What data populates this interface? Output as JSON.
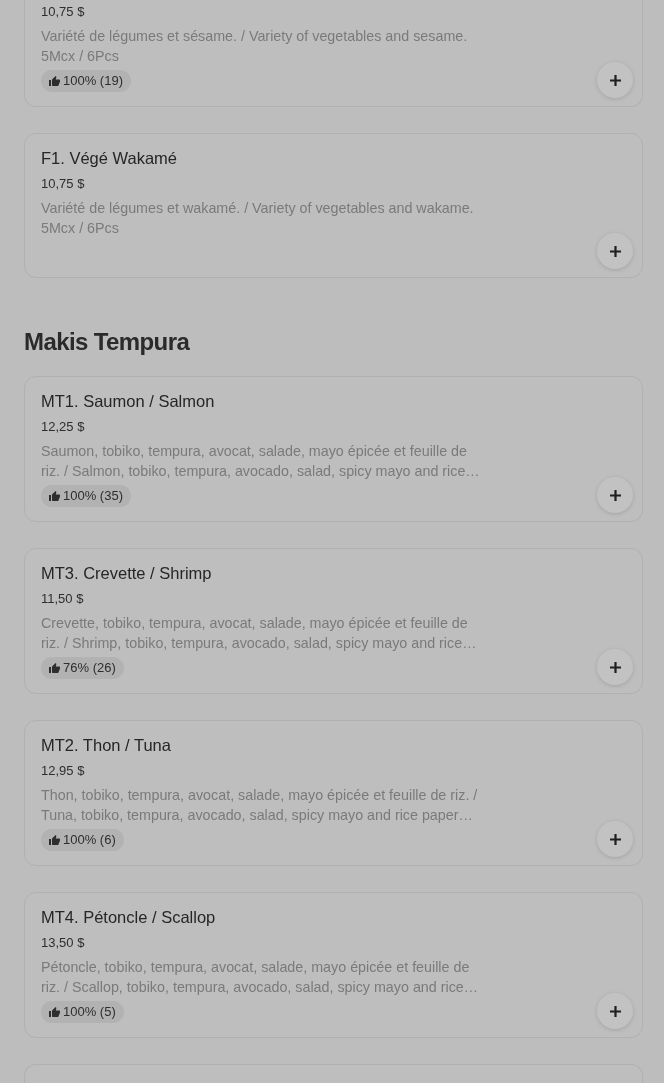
{
  "sections": [
    {
      "items": [
        {
          "kind": "clipped_top",
          "price": "10,75 $",
          "description": "Variété de légumes et sésame. / Variety of vegetables and sesame.\n5Mcx / 6Pcs",
          "rating": "100% (19)"
        },
        {
          "kind": "full",
          "title": "F1. Végé Wakamé",
          "price": "10,75 $",
          "description": "Variété de légumes et wakamé. / Variety of vegetables and wakame.\n5Mcx / 6Pcs"
        }
      ]
    },
    {
      "heading": "Makis Tempura",
      "items": [
        {
          "kind": "full",
          "title": "MT1. Saumon / Salmon",
          "price": "12,25 $",
          "description": "Saumon, tobiko, tempura, avocat, salade, mayo épicée et feuille de riz. / Salmon, tobiko, tempura, avocado, salad, spicy mayo and rice…",
          "rating": "100% (35)"
        },
        {
          "kind": "full",
          "title": "MT3. Crevette / Shrimp",
          "price": "11,50 $",
          "description": "Crevette, tobiko, tempura, avocat, salade, mayo épicée et feuille de riz. / Shrimp, tobiko, tempura, avocado, salad, spicy mayo and rice…",
          "rating": "76% (26)"
        },
        {
          "kind": "full",
          "title": "MT2. Thon / Tuna",
          "price": "12,95 $",
          "description": "Thon, tobiko, tempura, avocat, salade, mayo épicée et feuille de riz. / Tuna, tobiko, tempura, avocado, salad, spicy mayo and rice paper…",
          "rating": "100% (6)"
        },
        {
          "kind": "full",
          "title": "MT4. Pétoncle / Scallop",
          "price": "13,50 $",
          "description": "Pétoncle, tobiko, tempura, avocat, salade, mayo épicée et feuille de riz. / Scallop, tobiko, tempura, avocado, salad, spicy mayo and rice…",
          "rating": "100% (5)"
        },
        {
          "kind": "clipped_bottom"
        }
      ]
    }
  ]
}
